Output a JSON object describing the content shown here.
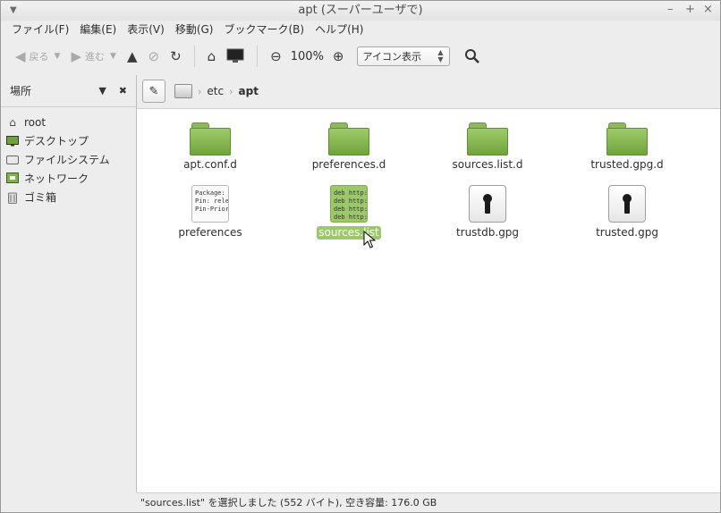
{
  "window": {
    "title": "apt (スーパーユーザで)"
  },
  "menubar": [
    "ファイル(F)",
    "編集(E)",
    "表示(V)",
    "移動(G)",
    "ブックマーク(B)",
    "ヘルプ(H)"
  ],
  "toolbar": {
    "back_label": "戻る",
    "forward_label": "進む",
    "zoom_level": "100%",
    "view_mode": "アイコン表示"
  },
  "sidebar": {
    "title": "場所",
    "items": [
      {
        "label": "root",
        "icon": "home-icon"
      },
      {
        "label": "デスクトップ",
        "icon": "desktop-icon"
      },
      {
        "label": "ファイルシステム",
        "icon": "drive-icon"
      },
      {
        "label": "ネットワーク",
        "icon": "network-icon"
      },
      {
        "label": "ゴミ箱",
        "icon": "trash-icon"
      }
    ]
  },
  "location": {
    "crumbs": [
      "etc",
      "apt"
    ]
  },
  "files": [
    {
      "name": "apt.conf.d",
      "kind": "folder"
    },
    {
      "name": "preferences.d",
      "kind": "folder"
    },
    {
      "name": "sources.list.d",
      "kind": "folder"
    },
    {
      "name": "trusted.gpg.d",
      "kind": "folder"
    },
    {
      "name": "preferences",
      "kind": "text",
      "preview": [
        "Package:",
        "Pin: rele",
        "Pin-Prior"
      ]
    },
    {
      "name": "sources.list",
      "kind": "text",
      "selected": true,
      "preview": [
        "deb http:",
        "deb http:",
        "deb http:",
        "deb http:"
      ]
    },
    {
      "name": "trustdb.gpg",
      "kind": "key"
    },
    {
      "name": "trusted.gpg",
      "kind": "key"
    }
  ],
  "status": "\"sources.list\" を選択しました (552 バイト), 空き容量: 176.0 GB",
  "colors": {
    "folder": "#7fb14a",
    "selection": "#9cc86b"
  }
}
